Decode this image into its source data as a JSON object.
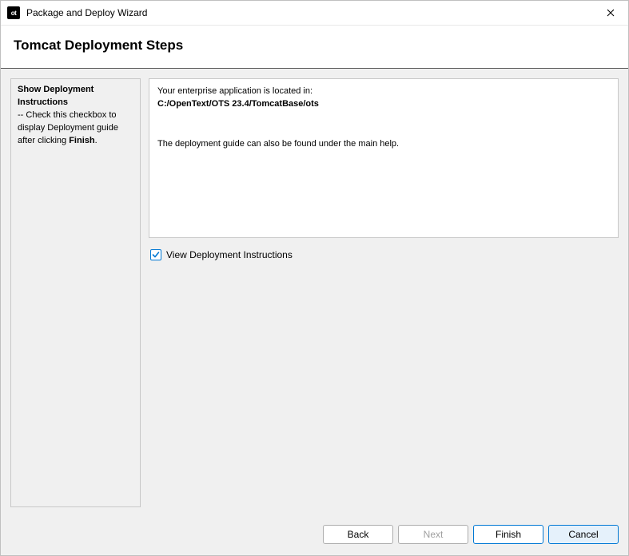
{
  "window": {
    "title": "Package and Deploy Wizard",
    "icon_text": "ot"
  },
  "header": {
    "title": "Tomcat Deployment Steps"
  },
  "side": {
    "heading": "Show Deployment Instructions",
    "desc_prefix": "-- Check this checkbox to display Deployment guide after clicking ",
    "desc_bold": "Finish",
    "desc_suffix": "."
  },
  "main": {
    "intro": "Your enterprise application is located in:",
    "path": "C:/OpenText/OTS 23.4/TomcatBase/ots",
    "help_note": "The deployment guide can also be found under the main help."
  },
  "checkbox": {
    "label": "View Deployment Instructions",
    "checked": true
  },
  "footer": {
    "back": "Back",
    "next": "Next",
    "finish": "Finish",
    "cancel": "Cancel"
  }
}
